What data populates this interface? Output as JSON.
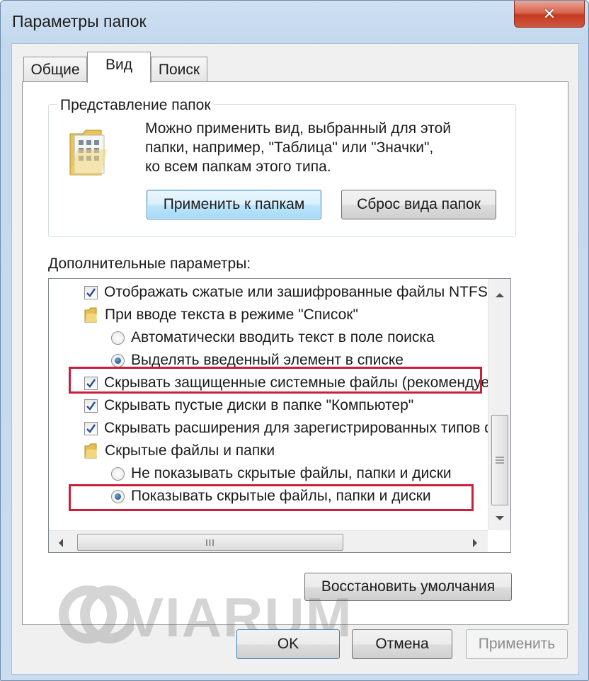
{
  "window": {
    "title": "Параметры папок",
    "close_glyph": "✕"
  },
  "tabs": [
    {
      "label": "Общие",
      "active": false
    },
    {
      "label": "Вид",
      "active": true
    },
    {
      "label": "Поиск",
      "active": false
    }
  ],
  "folder_view": {
    "group_title": "Представление папок",
    "description_lines": [
      "Можно применить вид, выбранный для этой",
      "папки, например, \"Таблица\" или \"Значки\",",
      "ко всем папкам этого типа."
    ],
    "apply_button": "Применить к папкам",
    "reset_button": "Сброс вида папок"
  },
  "advanced": {
    "label": "Дополнительные параметры:",
    "items": [
      {
        "type": "checkbox",
        "checked": true,
        "text": "Отображать сжатые или зашифрованные файлы NTFS"
      },
      {
        "type": "folder",
        "text": "При вводе текста в режиме \"Список\""
      },
      {
        "type": "radio",
        "checked": false,
        "text": "Автоматически вводить текст в поле поиска"
      },
      {
        "type": "radio",
        "checked": true,
        "text": "Выделять введенный элемент в списке"
      },
      {
        "type": "checkbox",
        "checked": true,
        "text": "Скрывать защищенные системные файлы (рекомендуется)",
        "highlighted": true
      },
      {
        "type": "checkbox",
        "checked": true,
        "text": "Скрывать пустые диски в папке \"Компьютер\""
      },
      {
        "type": "checkbox",
        "checked": true,
        "text": "Скрывать расширения для зарегистрированных типов файлов"
      },
      {
        "type": "folder",
        "text": "Скрытые файлы и папки"
      },
      {
        "type": "radio",
        "checked": false,
        "text": "Не показывать скрытые файлы, папки и диски"
      },
      {
        "type": "radio",
        "checked": true,
        "text": "Показывать скрытые файлы, папки и диски",
        "highlighted": true
      }
    ],
    "hscroll_grip": "III"
  },
  "buttons": {
    "restore_defaults": "Восстановить умолчания",
    "ok": "OK",
    "cancel": "Отмена",
    "apply": "Применить"
  },
  "watermark": "VIARUM",
  "colors": {
    "highlight_box": "#c8203a",
    "close_button": "#c23b22"
  }
}
